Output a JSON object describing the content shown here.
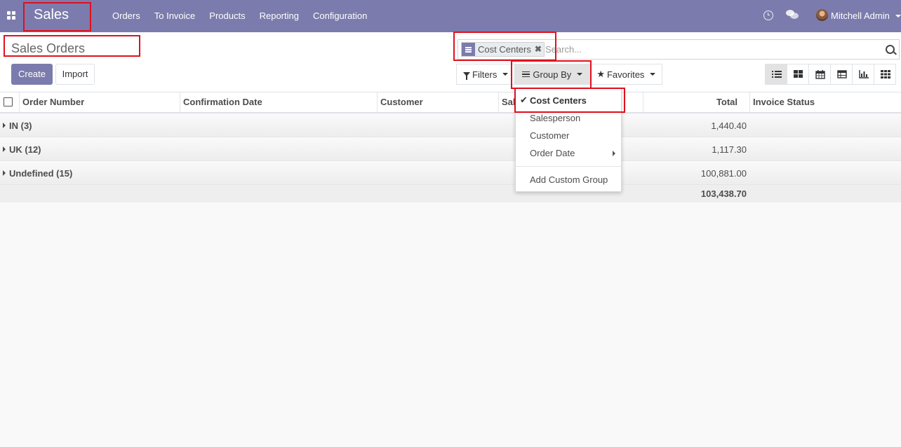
{
  "navbar": {
    "app_name": "Sales",
    "menu": [
      "Orders",
      "To Invoice",
      "Products",
      "Reporting",
      "Configuration"
    ],
    "user_name": "Mitchell Admin"
  },
  "control_panel": {
    "title": "Sales Orders",
    "create_label": "Create",
    "import_label": "Import",
    "search": {
      "facet_label": "Cost Centers",
      "placeholder": "Search..."
    },
    "filters_label": "Filters",
    "group_by_label": "Group By",
    "favorites_label": "Favorites",
    "views": [
      "list-view-icon",
      "kanban-view-icon",
      "calendar-view-icon",
      "pivot-view-icon",
      "graph-view-icon",
      "grid-view-icon"
    ]
  },
  "table": {
    "columns": [
      "Order Number",
      "Confirmation Date",
      "Customer",
      "Sal",
      "Total",
      "Invoice Status"
    ],
    "groups": [
      {
        "name": "IN (3)",
        "total": "1,440.40"
      },
      {
        "name": "UK (12)",
        "total": "1,117.30"
      },
      {
        "name": "Undefined (15)",
        "total": "100,881.00"
      }
    ],
    "grand_total": "103,438.70"
  },
  "group_by_menu": {
    "items": [
      "Cost Centers",
      "Salesperson",
      "Customer",
      "Order Date"
    ],
    "custom": "Add Custom Group"
  },
  "colors": {
    "brand": "#7c7bad",
    "highlight": "#e0101e"
  }
}
